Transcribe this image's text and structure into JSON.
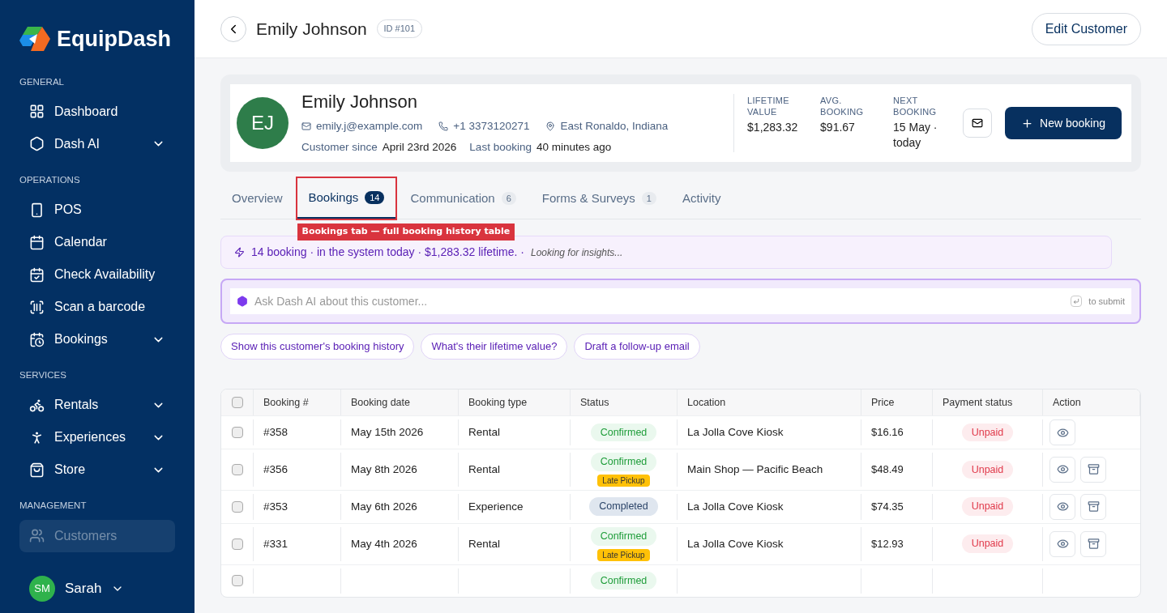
{
  "sidebar": {
    "brand": "EquipDash",
    "sections": [
      {
        "title": "GENERAL",
        "items": [
          {
            "label": "Dashboard",
            "expandable": false,
            "selected": false
          },
          {
            "label": "Dash AI",
            "expandable": true,
            "selected": false
          }
        ]
      },
      {
        "title": "OPERATIONS",
        "items": [
          {
            "label": "POS",
            "expandable": false,
            "selected": false
          },
          {
            "label": "Calendar",
            "expandable": false,
            "selected": false
          },
          {
            "label": "Check Availability",
            "expandable": false,
            "selected": false
          },
          {
            "label": "Scan a barcode",
            "expandable": false,
            "selected": false
          },
          {
            "label": "Bookings",
            "expandable": true,
            "selected": false
          }
        ]
      },
      {
        "title": "SERVICES",
        "items": [
          {
            "label": "Rentals",
            "expandable": true,
            "selected": false
          },
          {
            "label": "Experiences",
            "expandable": true,
            "selected": false
          },
          {
            "label": "Store",
            "expandable": true,
            "selected": false
          }
        ]
      },
      {
        "title": "MANAGEMENT",
        "items": [
          {
            "label": "Customers",
            "expandable": false,
            "selected": true
          }
        ]
      }
    ],
    "user": {
      "initials": "SM",
      "name": "Sarah"
    }
  },
  "header": {
    "title": "Emily Johnson",
    "id_badge": "ID #101",
    "edit_button": "Edit Customer"
  },
  "profile": {
    "initials": "EJ",
    "name": "Emily Johnson",
    "email": "emily.j@example.com",
    "phone": "+1 3373120271",
    "location": "East Ronaldo, Indiana",
    "since_label": "Customer since",
    "since": "April 23rd 2026",
    "last_label": "Last booking",
    "last": "40 minutes ago",
    "stats": [
      {
        "label": "LIFETIME VALUE",
        "value": "$1,283.32"
      },
      {
        "label": "AVG. BOOKING",
        "value": "$91.67"
      },
      {
        "label": "NEXT BOOKING",
        "value": "15 May · today"
      }
    ],
    "new_booking": "New booking"
  },
  "tabs": [
    {
      "label": "Overview",
      "selected": false
    },
    {
      "label": "Bookings",
      "count": "14",
      "selected": true
    },
    {
      "label": "Communication",
      "count": "6",
      "selected": false
    },
    {
      "label": "Forms & Surveys",
      "count": "1",
      "selected": false
    },
    {
      "label": "Activity",
      "selected": false
    }
  ],
  "annotation": "Bookings tab — full booking history table",
  "insight": {
    "text": "14 booking · in the system today · $1,283.32 lifetime. ·",
    "note": "Looking for insights..."
  },
  "ask": {
    "placeholder": "Ask Dash AI about this customer...",
    "hint": "to submit",
    "suggestions": [
      "Show this customer's booking history",
      "What's their lifetime value?",
      "Draft a follow-up email"
    ]
  },
  "table": {
    "all_checked": false,
    "columns": [
      "Booking #",
      "Booking date",
      "Booking type",
      "Status",
      "Location",
      "Price",
      "Payment status",
      "Action"
    ],
    "rows": [
      {
        "checked": false,
        "number": "#358",
        "date": "May 15th 2026",
        "type": "Rental",
        "status": {
          "text": "Confirmed",
          "kind": "confirmed"
        },
        "location": "La Jolla Cove Kiosk",
        "price": "$16.16",
        "payment": "Unpaid",
        "archivable": false
      },
      {
        "checked": false,
        "number": "#356",
        "date": "May 8th 2026",
        "type": "Rental",
        "status": {
          "text": "Confirmed",
          "kind": "confirmed"
        },
        "tag": "Late Pickup",
        "location": "Main Shop — Pacific Beach",
        "price": "$48.49",
        "payment": "Unpaid",
        "archivable": true
      },
      {
        "checked": false,
        "number": "#353",
        "date": "May 6th 2026",
        "type": "Experience",
        "status": {
          "text": "Completed",
          "kind": "completed"
        },
        "location": "La Jolla Cove Kiosk",
        "price": "$74.35",
        "payment": "Unpaid",
        "archivable": true
      },
      {
        "checked": false,
        "number": "#331",
        "date": "May 4th 2026",
        "type": "Rental",
        "status": {
          "text": "Confirmed",
          "kind": "confirmed"
        },
        "tag": "Late Pickup",
        "location": "La Jolla Cove Kiosk",
        "price": "$12.93",
        "payment": "Unpaid",
        "archivable": true
      },
      {
        "checked": false,
        "status": {
          "text": "Confirmed",
          "kind": "confirmed"
        }
      }
    ]
  }
}
